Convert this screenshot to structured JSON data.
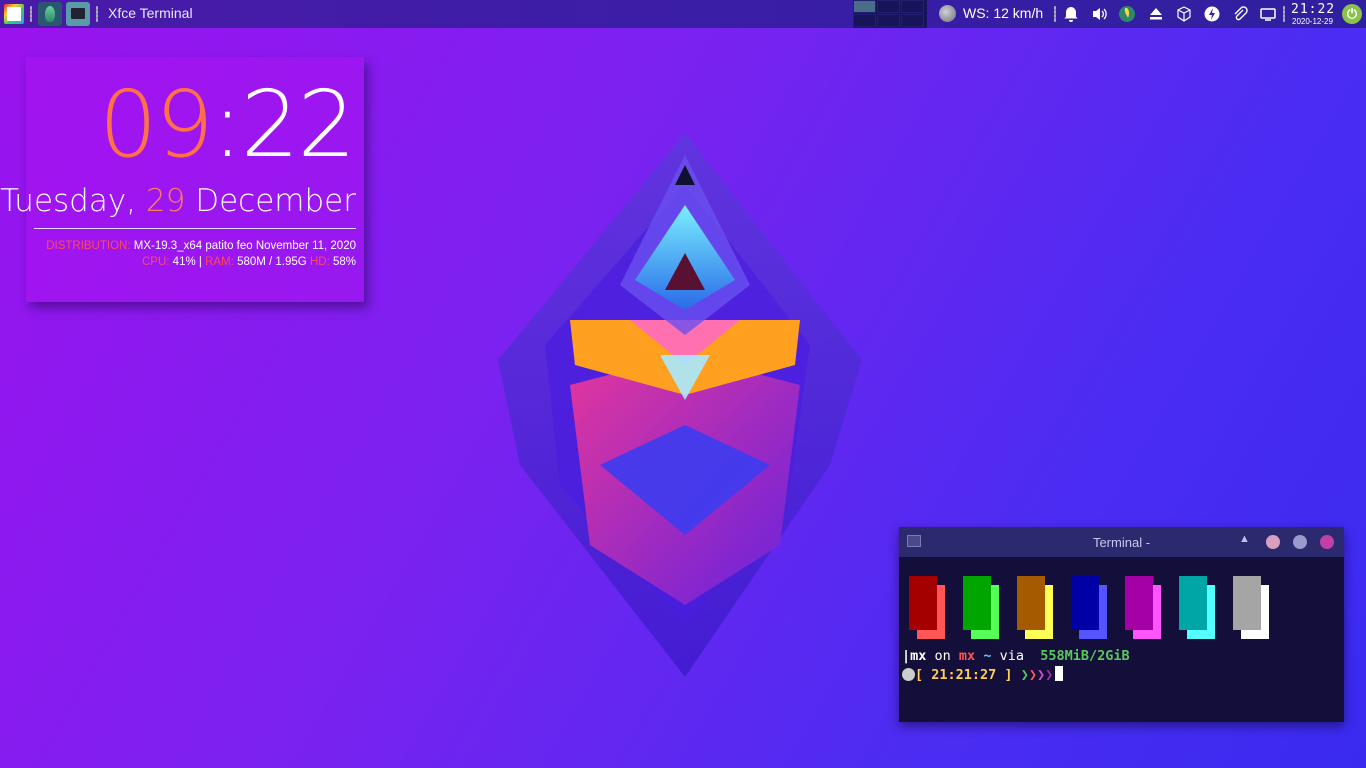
{
  "panel": {
    "window_title": "Xfce Terminal",
    "weather": "WS: 12 km/h",
    "clock_time": "21:22",
    "clock_date": "2020-12-29",
    "tray_icons": [
      "bell-icon",
      "volume-icon",
      "network-icon",
      "eject-icon",
      "package-icon",
      "flash-icon",
      "clip-icon",
      "display-icon"
    ]
  },
  "conky": {
    "hours": "09",
    "colon": ":",
    "minutes": "22",
    "weekday": "Tuesday,",
    "day": "29",
    "month": "December",
    "dist_label": "DISTRIBUTION:",
    "dist_value": "MX-19.3_x64 patito feo November 11, 2020",
    "cpu_label": "CPU:",
    "cpu_value": "41%",
    "sep": "|",
    "ram_label": "RAM:",
    "ram_value": "580M / 1.95G",
    "hd_label": "HD:",
    "hd_value": "58%"
  },
  "terminal": {
    "title": "Terminal -",
    "colors": {
      "dark": [
        "#a50000",
        "#00a500",
        "#a55a00",
        "#0000a5",
        "#a500a5",
        "#00a5a5",
        "#a5a5a5"
      ],
      "bright": [
        "#ff5555",
        "#55ff55",
        "#ffff55",
        "#5555ff",
        "#ff55ff",
        "#55ffff",
        "#ffffff"
      ]
    },
    "prompt": {
      "bar": "|",
      "user": "mx",
      "on": " on ",
      "host": "mx",
      "dir": " ~",
      "via": " via ",
      "mem": " 558MiB/2GiB",
      "open_bracket": "[",
      "time": " 21:21:27 ",
      "close_bracket": "]"
    }
  }
}
